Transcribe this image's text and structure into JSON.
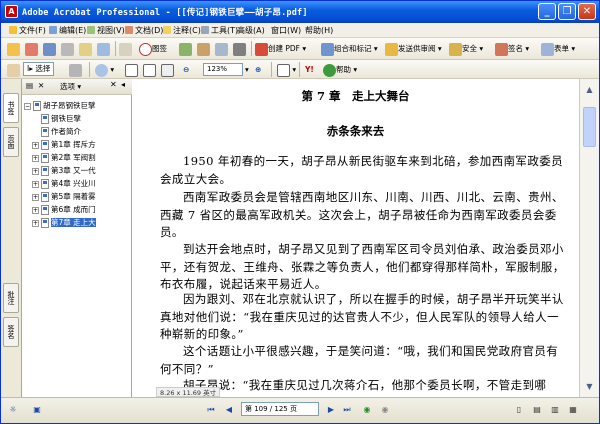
{
  "window": {
    "title": "Adobe Acrobat Professional - [[传记]钢铁巨擘——胡子昂.pdf]",
    "minimize_label": "_",
    "restore_label": "❐",
    "close_label": "✕"
  },
  "menu": [
    "文件(F)",
    "编辑(E)",
    "视图(V)",
    "文档(D)",
    "注释(C)",
    "工具(T)",
    "高级(A)",
    "窗口(W)",
    "帮助(H)"
  ],
  "toolbar1": {
    "create_pdf": "创建 PDF",
    "combine": "组合和标记",
    "send_review": "发送供审阅",
    "secure": "安全",
    "sign": "签名",
    "forms": "表单",
    "intro": "图签"
  },
  "toolbar2": {
    "select_label": "选择",
    "zoom": "123%",
    "help_label": "帮助"
  },
  "left_tabs": [
    "书签",
    "页面",
    "批注",
    "签名"
  ],
  "panel": {
    "options_label": "选项"
  },
  "bookmarks": [
    {
      "label": "胡子昂钢铁巨擘",
      "expand": "−",
      "level": 0,
      "selected": false
    },
    {
      "label": "钢铁巨擘",
      "expand": "",
      "level": 1,
      "selected": false
    },
    {
      "label": "作者简介",
      "expand": "",
      "level": 1,
      "selected": false
    },
    {
      "label": "第1章 挥斥方",
      "expand": "+",
      "level": 1,
      "selected": false
    },
    {
      "label": "第2章 军阀割",
      "expand": "+",
      "level": 1,
      "selected": false
    },
    {
      "label": "第3章 又一代",
      "expand": "+",
      "level": 1,
      "selected": false
    },
    {
      "label": "第4章 兴业川",
      "expand": "+",
      "level": 1,
      "selected": false
    },
    {
      "label": "第5章 隔着雾",
      "expand": "+",
      "level": 1,
      "selected": false
    },
    {
      "label": "第6章 成而门",
      "expand": "+",
      "level": 1,
      "selected": false
    },
    {
      "label": "第7章 走上大",
      "expand": "+",
      "level": 1,
      "selected": true
    }
  ],
  "document": {
    "chapter_title": "第 7 章　走上大舞台",
    "section_title": "赤条条来去",
    "paragraphs": [
      "1950 年初春的一天，胡子昂从新民街驱车来到北碚，参加西南军政委员会成立大会。",
      "西南军政委员会是管辖西南地区川东、川南、川西、川北、云南、贵州、西藏 7 省区的最高军政机关。这次会上，胡子昂被任命为西南军政委员会委员。",
      "到达开会地点时，胡子昂又见到了西南军区司令员刘伯承、政治委员邓小平，还有贺龙、王维舟、张霖之等负责人，他们都穿得那样简朴，军服制服，布衣布履，说起话来平易近人。",
      "因为跟刘、邓在北京就认识了，所以在握手的时候，胡子昂半开玩笑半认真地对他们说：“我在重庆见过的达官贵人不少，但人民军队的领导人给人一种崭新的印象。”",
      "这个话题让小平很感兴趣，于是笑问道：“哦，我们和国民党政府官员有何不同？”",
      "胡子昂说：“我在重庆见过几次蒋介石，他那个委员长啊，不管走到哪"
    ],
    "page_size": "8.26 x 11.69 英寸"
  },
  "status": {
    "page_indicator": "第 109 / 125 页"
  },
  "colors": {
    "titlebar": "#0a5ddc",
    "selection": "#316ac5"
  }
}
